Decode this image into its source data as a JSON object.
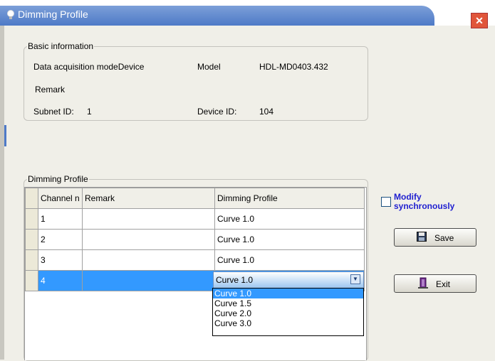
{
  "window": {
    "title": "Dimming Profile",
    "close_glyph": "✕"
  },
  "basic_info": {
    "legend": "Basic information",
    "mode_label": "Data acquisition modeDevice",
    "model_label": "Model",
    "model_value": "HDL-MD0403.432",
    "remark_label": "Remark",
    "subnet_label": "Subnet ID:",
    "subnet_value": "1",
    "device_label": "Device ID:",
    "device_value": "104"
  },
  "dimming": {
    "legend": "Dimming Profile",
    "columns": [
      "Channel n",
      "Remark",
      "Dimming Profile"
    ],
    "rows": [
      {
        "channel": "1",
        "remark": "",
        "profile": "Curve 1.0"
      },
      {
        "channel": "2",
        "remark": "",
        "profile": "Curve 1.0"
      },
      {
        "channel": "3",
        "remark": "",
        "profile": "Curve 1.0"
      },
      {
        "channel": "4",
        "remark": "",
        "profile": "Curve 1.0"
      }
    ],
    "selected_row": 4,
    "dropdown_options": [
      "Curve 1.0",
      "Curve 1.5",
      "Curve 2.0",
      "Curve 3.0"
    ],
    "dropdown_highlighted": "Curve 1.0"
  },
  "controls": {
    "modify_sync_line1": "Modify",
    "modify_sync_line2": "synchronously",
    "modify_sync_checked": false,
    "save_label": "Save",
    "exit_label": "Exit"
  },
  "colors": {
    "accent": "#3399ff",
    "title_bar": "#4e7ac7",
    "checkbox_label": "#1f1fd0",
    "close": "#e0553a"
  },
  "icons": {
    "title": "bulb-icon",
    "save": "floppy-disk-icon",
    "exit": "exit-door-icon",
    "dropdown": "chevron-down-icon"
  }
}
